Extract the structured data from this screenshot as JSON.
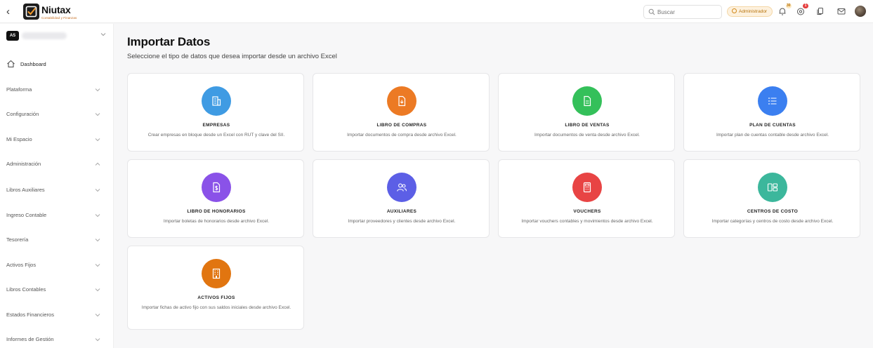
{
  "app": {
    "brand_name": "Niutax",
    "brand_tagline": "Contabilidad y Finanzas",
    "back_glyph": "‹"
  },
  "header": {
    "search_placeholder": "Buscar",
    "role_label": "Administrador",
    "notification_count": "30",
    "alerts_count": "1"
  },
  "sidebar": {
    "org_initials": "AS",
    "items": [
      {
        "label": "Dashboard",
        "expanded": false
      },
      {
        "label": "Plataforma",
        "expanded": false
      },
      {
        "label": "Configuración",
        "expanded": false
      },
      {
        "label": "Mi Espacio",
        "expanded": false
      },
      {
        "label": "Administración",
        "expanded": true
      },
      {
        "label": "Libros Auxiliares",
        "expanded": false
      },
      {
        "label": "Ingreso Contable",
        "expanded": false
      },
      {
        "label": "Tesorería",
        "expanded": false
      },
      {
        "label": "Activos Fijos",
        "expanded": false
      },
      {
        "label": "Libros Contables",
        "expanded": false
      },
      {
        "label": "Estados Financieros",
        "expanded": false
      },
      {
        "label": "Informes de Gestión",
        "expanded": false
      }
    ]
  },
  "main": {
    "title": "Importar Datos",
    "subtitle": "Seleccione el tipo de datos que desea importar desde un archivo Excel",
    "cards": [
      {
        "title": "EMPRESAS",
        "desc": "Crear empresas en bloque desde un Excel con RUT y clave del SII.",
        "color": "#3f9be3",
        "icon": "building-icon"
      },
      {
        "title": "LIBRO DE COMPRAS",
        "desc": "Importar documentos de compra desde archivo Excel.",
        "color": "#ec7a24",
        "icon": "file-download-icon"
      },
      {
        "title": "LIBRO DE VENTAS",
        "desc": "Importar documentos de venta desde archivo Excel.",
        "color": "#34c05a",
        "icon": "document-icon"
      },
      {
        "title": "PLAN DE CUENTAS",
        "desc": "Importar plan de cuentas contable desde archivo Excel.",
        "color": "#3b7ff0",
        "icon": "list-icon"
      },
      {
        "title": "LIBRO DE HONORARIOS",
        "desc": "Importar boletas de honorarios desde archivo Excel.",
        "color": "#8a52e8",
        "icon": "receipt-icon"
      },
      {
        "title": "AUXILIARES",
        "desc": "Importar proveedores y clientes desde archivo Excel.",
        "color": "#5c5fe6",
        "icon": "users-icon"
      },
      {
        "title": "VOUCHERS",
        "desc": "Importar vouchers contables y movimientos desde archivo Excel.",
        "color": "#e84444",
        "icon": "calculator-icon"
      },
      {
        "title": "CENTROS DE COSTO",
        "desc": "Importar categorías y centros de costo desde archivo Excel.",
        "color": "#3cb79c",
        "icon": "layout-icon"
      },
      {
        "title": "ACTIVOS FIJOS",
        "desc": "Importar fichas de activo fijo con sus saldos iniciales desde archivo Excel.",
        "color": "#e17510",
        "icon": "office-building-icon"
      }
    ]
  }
}
